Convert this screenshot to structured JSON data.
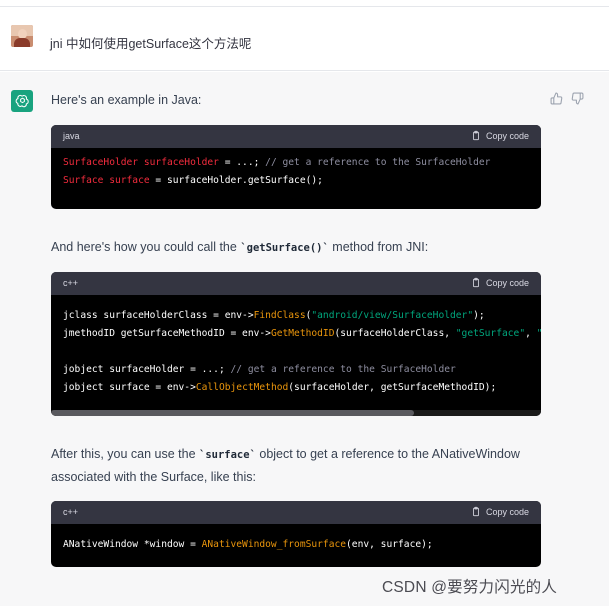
{
  "user": {
    "message": "jni 中如何使用getSurface这个方法呢"
  },
  "assistant": {
    "intro": "Here's an example in Java:",
    "para2_pre": "And here's how you could call the ",
    "para2_code": "`getSurface()`",
    "para2_post": " method from JNI:",
    "para3_line1_pre": "After this, you can use the ",
    "para3_code": "`surface`",
    "para3_line1_post": " object to get a reference to the ANativeWindow",
    "para3_line2": "associated with the Surface, like this:"
  },
  "code_blocks": [
    {
      "lang": "java",
      "copy_label": "Copy code",
      "lines": [
        [
          {
            "t": "SurfaceHolder surfaceHolder",
            "c": "type"
          },
          {
            "t": " = ...; ",
            "c": "plain"
          },
          {
            "t": "// get a reference to the SurfaceHolder",
            "c": "comment"
          }
        ],
        [
          {
            "t": "Surface surface",
            "c": "type"
          },
          {
            "t": " = surfaceHolder.getSurface();",
            "c": "plain"
          }
        ]
      ]
    },
    {
      "lang": "c++",
      "copy_label": "Copy code",
      "lines": [
        [
          {
            "t": "jclass surfaceHolderClass = env->",
            "c": "plain"
          },
          {
            "t": "FindClass",
            "c": "fn"
          },
          {
            "t": "(",
            "c": "plain"
          },
          {
            "t": "\"android/view/SurfaceHolder\"",
            "c": "str"
          },
          {
            "t": ");",
            "c": "plain"
          }
        ],
        [
          {
            "t": "jmethodID getSurfaceMethodID = env->",
            "c": "plain"
          },
          {
            "t": "GetMethodID",
            "c": "fn"
          },
          {
            "t": "(surfaceHolderClass, ",
            "c": "plain"
          },
          {
            "t": "\"getSurface\"",
            "c": "str"
          },
          {
            "t": ", ",
            "c": "plain"
          },
          {
            "t": "\"",
            "c": "str"
          }
        ],
        [],
        [
          {
            "t": "jobject surfaceHolder = ...; ",
            "c": "plain"
          },
          {
            "t": "// get a reference to the SurfaceHolder",
            "c": "comment"
          }
        ],
        [
          {
            "t": "jobject surface = env->",
            "c": "plain"
          },
          {
            "t": "CallObjectMethod",
            "c": "fn"
          },
          {
            "t": "(surfaceHolder, getSurfaceMethodID);",
            "c": "plain"
          }
        ]
      ]
    },
    {
      "lang": "c++",
      "copy_label": "Copy code",
      "lines": [
        [
          {
            "t": "ANativeWindow *window = ",
            "c": "plain"
          },
          {
            "t": "ANativeWindow_fromSurface",
            "c": "fn"
          },
          {
            "t": "(env, surface);",
            "c": "plain"
          }
        ]
      ]
    }
  ],
  "watermark": "CSDN @要努力闪光的人",
  "colors": {
    "accent_green": "#19a37f",
    "code_type": "#f22c3d",
    "code_comment": "#8e8ea0",
    "code_function": "#e9950c",
    "code_string": "#00a67d"
  }
}
